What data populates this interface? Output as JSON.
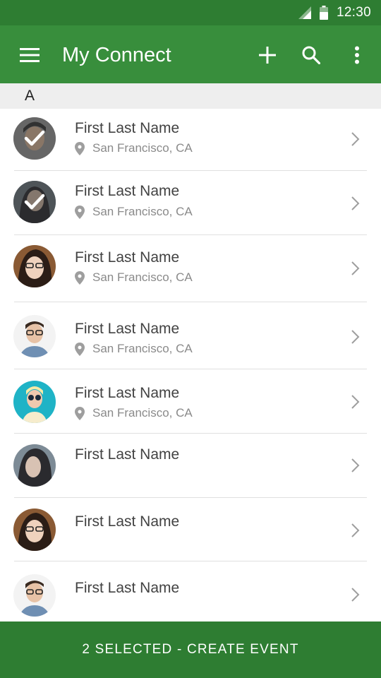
{
  "status_bar": {
    "time": "12:30",
    "icons": [
      "signal-icon",
      "battery-icon"
    ]
  },
  "app_bar": {
    "title": "My Connect",
    "icons": [
      "menu-icon",
      "add-icon",
      "search-icon",
      "more-vert-icon"
    ]
  },
  "section": {
    "letter": "A"
  },
  "contacts": [
    {
      "name": "First Last Name",
      "location": "San Francisco, CA",
      "selected": true,
      "avatar_bg": "#8d8d8d"
    },
    {
      "name": "First Last Name",
      "location": "San Francisco, CA",
      "selected": true,
      "avatar_bg": "#5f6b73"
    },
    {
      "name": "First Last Name",
      "location": "San Francisco, CA",
      "selected": false,
      "avatar_bg": "#7a4a2a"
    },
    {
      "name": "First Last Name",
      "location": "San Francisco, CA",
      "selected": false,
      "avatar_bg": "#f2f2f2"
    },
    {
      "name": "First Last Name",
      "location": "San Francisco, CA",
      "selected": false,
      "avatar_bg": "#1fb3c6"
    },
    {
      "name": "First Last Name",
      "location": "",
      "selected": false,
      "avatar_bg": "#4b5a66"
    },
    {
      "name": "First Last Name",
      "location": "",
      "selected": false,
      "avatar_bg": "#7a4a2a"
    },
    {
      "name": "First Last Name",
      "location": "",
      "selected": false,
      "avatar_bg": "#f2f2f2"
    }
  ],
  "bottom_action": {
    "label": "2 SELECTED - CREATE EVENT"
  },
  "colors": {
    "primary": "#388e3c",
    "primary_dark": "#2e7d32",
    "section_bg": "#eeeeee"
  }
}
